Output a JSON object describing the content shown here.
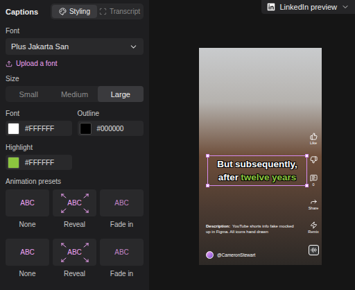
{
  "panel": {
    "title": "Captions",
    "tabs": [
      {
        "label": "Styling",
        "selected": true,
        "kind": "styling"
      },
      {
        "label": "Transcript",
        "selected": false,
        "kind": "transcript"
      }
    ]
  },
  "font": {
    "label": "Font",
    "value": "Plus Jakarta San"
  },
  "upload": {
    "label": "Upload a font"
  },
  "size": {
    "label": "Size",
    "options": [
      {
        "label": "Small",
        "selected": false
      },
      {
        "label": "Medium",
        "selected": false
      },
      {
        "label": "Large",
        "selected": true
      }
    ]
  },
  "colors": [
    {
      "label": "Font",
      "value": "#FFFFFF",
      "color": "#ffffff"
    },
    {
      "label": "Outline",
      "value": "#000000",
      "color": "#000000"
    }
  ],
  "highlight": {
    "label": "Highlight",
    "value": "#FFFFFF",
    "color": "#8cc63f"
  },
  "animation": {
    "label": "Animation presets",
    "presets": [
      {
        "sample": "ABC",
        "label": "None",
        "kind": "none"
      },
      {
        "sample": "ABC",
        "label": "Reveal",
        "kind": "reveal"
      },
      {
        "sample": "ABC",
        "label": "Fade in",
        "kind": "fade"
      },
      {
        "sample": "ABC",
        "label": "None",
        "kind": "none"
      },
      {
        "sample": "ABC",
        "label": "Reveal",
        "kind": "reveal"
      },
      {
        "sample": "ABC",
        "label": "Fade in",
        "kind": "fade"
      }
    ]
  },
  "preview": {
    "button": "LinkedIn preview",
    "caption": {
      "lines": [
        [
          {
            "text": "But",
            "highlighted": false
          },
          {
            "text": "subsequently,",
            "highlighted": false
          }
        ],
        [
          {
            "text": "after",
            "highlighted": false
          },
          {
            "text": "twelve",
            "highlighted": true
          },
          {
            "text": "years",
            "highlighted": true
          }
        ]
      ]
    },
    "actions": [
      {
        "kind": "like",
        "label": "Like"
      },
      {
        "kind": "dislike"
      },
      {
        "kind": "comment",
        "label": "0"
      },
      {
        "kind": "share",
        "label": "Share"
      },
      {
        "kind": "remix",
        "label": "Remix"
      },
      {
        "kind": "sound"
      }
    ],
    "description": {
      "label": "Description:",
      "text": "YouTube shorts info fake mocked up in Figma. All icons hand drawn"
    },
    "handle": "@CameronStewart"
  }
}
